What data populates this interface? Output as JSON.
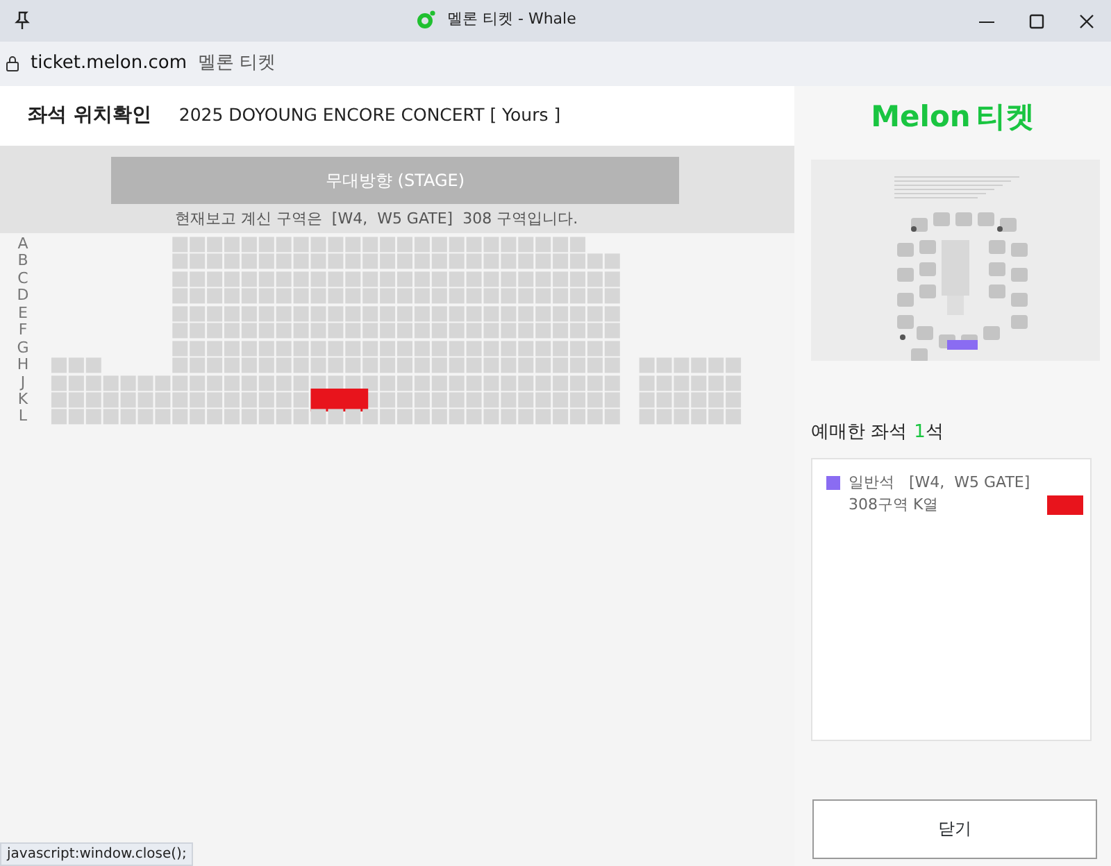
{
  "window": {
    "title": "멜론 티켓 - Whale"
  },
  "address_bar": {
    "url": "ticket.melon.com",
    "page_title": "멜론 티켓"
  },
  "header": {
    "title": "좌석 위치확인",
    "concert": "2025 DOYOUNG ENCORE CONCERT [ Yours ]"
  },
  "stage": {
    "label": "무대방향 (STAGE)",
    "caption": "현재보고 계신 구역은  [W4,  W5 GATE]  308 구역입니다."
  },
  "seat_map": {
    "rows": [
      {
        "label": "A",
        "selected": false
      },
      {
        "label": "B",
        "selected": false
      },
      {
        "label": "C",
        "selected": false
      },
      {
        "label": "D",
        "selected": false
      },
      {
        "label": "E",
        "selected": false
      },
      {
        "label": "F",
        "selected": false
      },
      {
        "label": "G",
        "selected": false
      },
      {
        "label": "H",
        "selected": false
      },
      {
        "label": "J",
        "selected": false
      },
      {
        "label": "K",
        "selected": true
      },
      {
        "label": "L",
        "selected": false
      }
    ]
  },
  "side": {
    "logo_word": "Melon",
    "logo_suffix": "티켓",
    "booked_label": "예매한 좌석",
    "booked_count": "1",
    "booked_unit": "석",
    "booked_seats": [
      {
        "grade": "일반석",
        "text": "[W4,  W5 GATE]  308구역 K열",
        "color": "#8a6cf2"
      }
    ],
    "close_button": "닫기"
  },
  "status_bar": "javascript:window.close();"
}
